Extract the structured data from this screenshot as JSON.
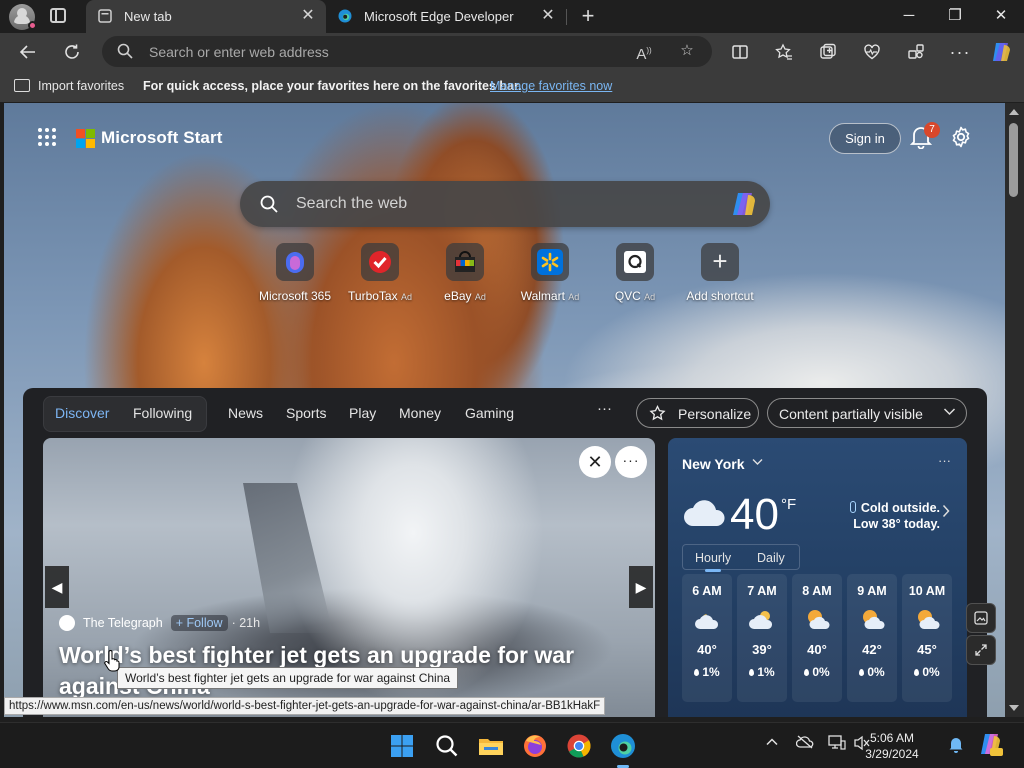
{
  "tabs": [
    {
      "label": "New tab",
      "icon": "new-tab-page-icon",
      "active": true
    },
    {
      "label": "Microsoft Edge Developer",
      "icon": "edge-logo-icon",
      "active": false
    }
  ],
  "window_controls": {
    "minimize": "─",
    "restore": "❐",
    "close": "✕"
  },
  "address_bar": {
    "placeholder": "Search or enter web address"
  },
  "favorites_bar": {
    "import_label": "Import favorites",
    "message": "For quick access, place your favorites here on the favorites bar.",
    "manage_link": "Manage favorites now"
  },
  "page": {
    "brand": "Microsoft Start",
    "sign_in": "Sign in",
    "notification_count": "7",
    "search_placeholder": "Search the web",
    "shortcuts": [
      {
        "label": "Microsoft 365",
        "ad": ""
      },
      {
        "label": "TurboTax",
        "ad": "Ad"
      },
      {
        "label": "eBay",
        "ad": "Ad"
      },
      {
        "label": "Walmart",
        "ad": "Ad"
      },
      {
        "label": "QVC",
        "ad": "Ad"
      },
      {
        "label": "Add shortcut",
        "ad": ""
      }
    ]
  },
  "feed": {
    "tabs": [
      "Discover",
      "Following",
      "News",
      "Sports",
      "Play",
      "Money",
      "Gaming"
    ],
    "more": "···",
    "personalize": "Personalize",
    "content_visibility": "Content partially visible",
    "hero": {
      "source": "The Telegraph",
      "follow": "+ Follow",
      "age": "· 21h",
      "headline": "World’s best fighter jet gets an upgrade for war against China"
    }
  },
  "weather": {
    "city": "New York",
    "temperature": "40",
    "unit": "°F",
    "note": "Cold outside. Low 38° today.",
    "tabs": [
      "Hourly",
      "Daily"
    ],
    "hourly": [
      {
        "time": "6 AM",
        "temp": "40°",
        "precip": "1%",
        "icon": "cloudy-night-icon"
      },
      {
        "time": "7 AM",
        "temp": "39°",
        "precip": "1%",
        "icon": "cloudy-icon"
      },
      {
        "time": "8 AM",
        "temp": "40°",
        "precip": "0%",
        "icon": "partly-sunny-icon"
      },
      {
        "time": "9 AM",
        "temp": "42°",
        "precip": "0%",
        "icon": "partly-sunny-icon"
      },
      {
        "time": "10 AM",
        "temp": "45°",
        "precip": "0%",
        "icon": "partly-sunny-icon"
      }
    ]
  },
  "tooltip": "World’s best fighter jet gets an upgrade for war against China",
  "status_url": "https://www.msn.com/en-us/news/world/world-s-best-fighter-jet-gets-an-upgrade-for-war-against-china/ar-BB1kHakF",
  "taskbar": {
    "time": "5:06 AM",
    "date": "3/29/2024"
  },
  "colors": {
    "accent": "#7db5f3",
    "notification_badge": "#d9472b"
  }
}
